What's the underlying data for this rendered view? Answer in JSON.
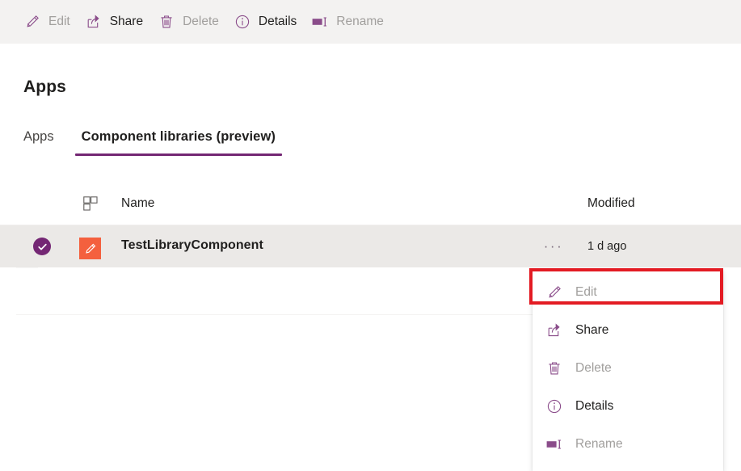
{
  "colors": {
    "brand_purple": "#742774",
    "command_bar_bg": "#f3f2f1",
    "row_selected_bg": "#ebe9e7",
    "app_icon_orange": "#f4603e",
    "annotation_red": "#e31b23",
    "disabled_text": "#a19f9d",
    "primary_text": "#201f1e"
  },
  "command_bar": {
    "items": [
      {
        "label": "Edit",
        "icon": "pencil-icon",
        "disabled": true
      },
      {
        "label": "Share",
        "icon": "share-icon",
        "disabled": false
      },
      {
        "label": "Delete",
        "icon": "trash-icon",
        "disabled": true
      },
      {
        "label": "Details",
        "icon": "info-icon",
        "disabled": false
      },
      {
        "label": "Rename",
        "icon": "rename-icon",
        "disabled": true
      }
    ]
  },
  "page": {
    "title": "Apps"
  },
  "tabs": {
    "items": [
      {
        "label": "Apps",
        "active": false
      },
      {
        "label": "Component libraries (preview)",
        "active": true
      }
    ]
  },
  "list": {
    "columns": {
      "icon": "component-grid-icon",
      "name": "Name",
      "modified": "Modified"
    },
    "rows": [
      {
        "selected": true,
        "check_icon": "checkmark-circle-icon",
        "app_icon": "app-pencil-icon",
        "name": "TestLibraryComponent",
        "more_icon": "ellipsis-icon",
        "more_label": "···",
        "modified": "1 d ago"
      }
    ]
  },
  "context_menu": {
    "items": [
      {
        "label": "Edit",
        "icon": "pencil-icon",
        "disabled": true,
        "highlighted": true
      },
      {
        "label": "Share",
        "icon": "share-icon",
        "disabled": false,
        "highlighted": false
      },
      {
        "label": "Delete",
        "icon": "trash-icon",
        "disabled": true,
        "highlighted": false
      },
      {
        "label": "Details",
        "icon": "info-icon",
        "disabled": false,
        "highlighted": false
      },
      {
        "label": "Rename",
        "icon": "rename-icon",
        "disabled": true,
        "highlighted": false
      }
    ]
  },
  "annotation": {
    "type": "red-rectangle-highlight",
    "target": "Edit"
  }
}
